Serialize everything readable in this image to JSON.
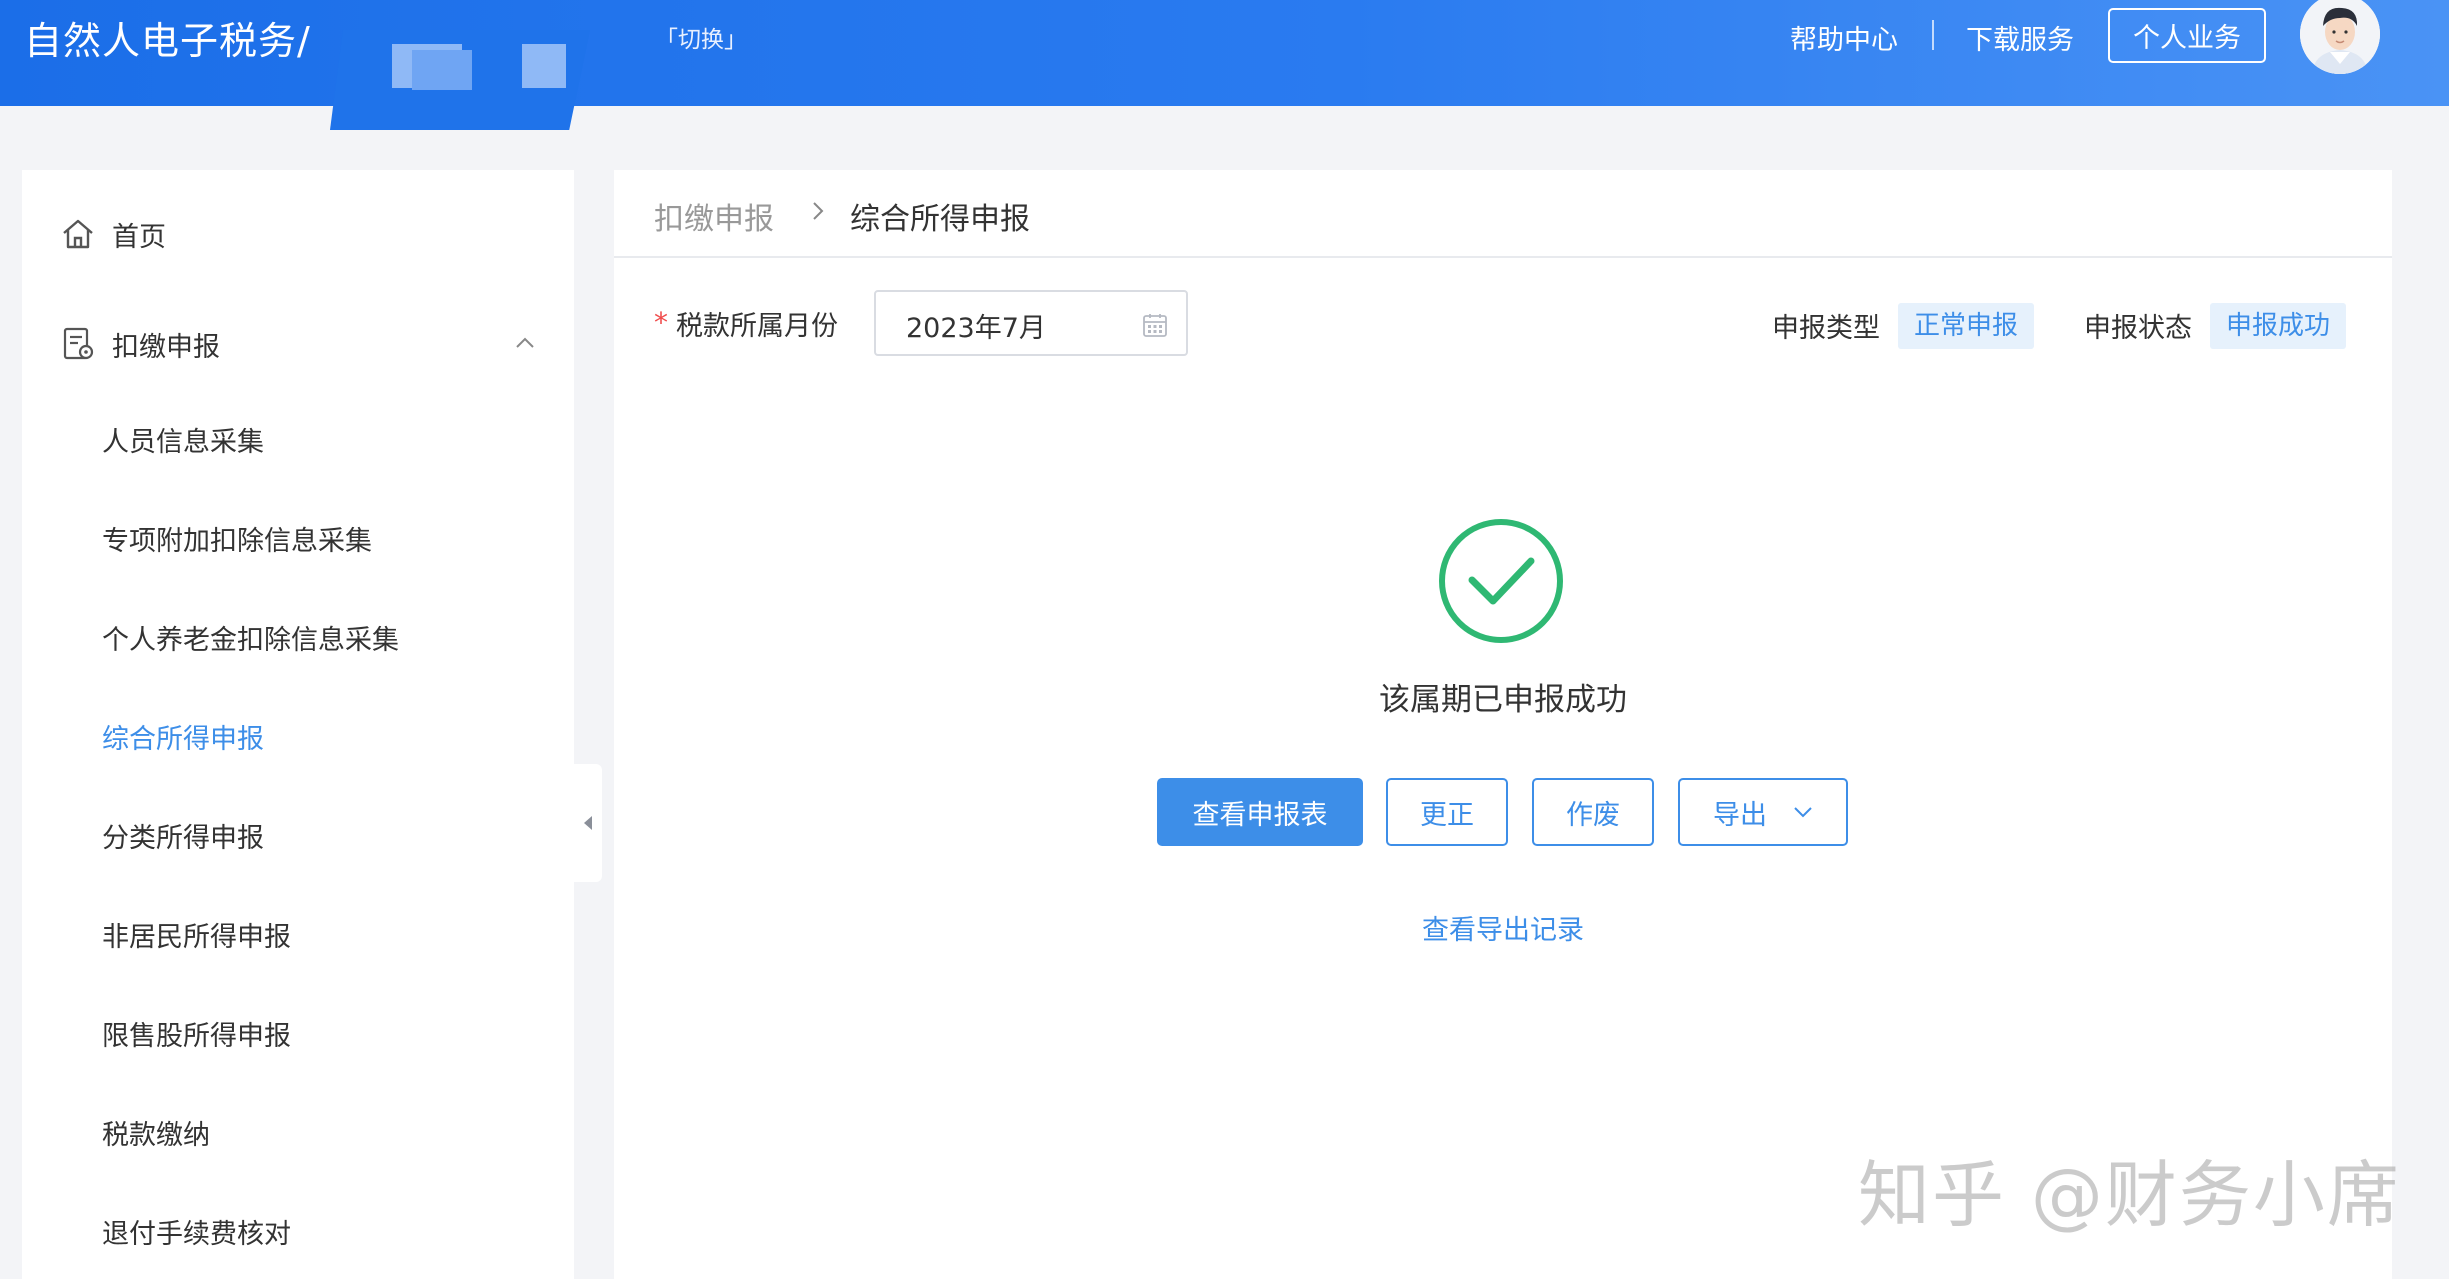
{
  "header": {
    "app_title": "自然人电子税务/",
    "switch": "「切换」",
    "help": "帮助中心",
    "download": "下载服务",
    "personal": "个人业务"
  },
  "sidebar": {
    "home": "首页",
    "group": "扣缴申报",
    "items": [
      {
        "label": "人员信息采集"
      },
      {
        "label": "专项附加扣除信息采集"
      },
      {
        "label": "个人养老金扣除信息采集"
      },
      {
        "label": "综合所得申报",
        "active": true
      },
      {
        "label": "分类所得申报"
      },
      {
        "label": "非居民所得申报"
      },
      {
        "label": "限售股所得申报"
      },
      {
        "label": "税款缴纳"
      },
      {
        "label": "退付手续费核对"
      }
    ]
  },
  "breadcrumb": {
    "parent": "扣缴申报",
    "current": "综合所得申报"
  },
  "form": {
    "required_mark": "*",
    "month_label": "税款所属月份",
    "month_value": "2023年7月",
    "type_label": "申报类型",
    "type_value": "正常申报",
    "status_label": "申报状态",
    "status_value": "申报成功"
  },
  "result": {
    "message": "该属期已申报成功",
    "buttons": {
      "view": "查看申报表",
      "correct": "更正",
      "void": "作废",
      "export": "导出"
    },
    "export_record_link": "查看导出记录"
  },
  "watermark": "知乎 @财务小席",
  "colors": {
    "header_blue": "#1b6ee8",
    "accent": "#3d8ee8",
    "success_green": "#2fb873",
    "required_red": "#f04d4d"
  }
}
